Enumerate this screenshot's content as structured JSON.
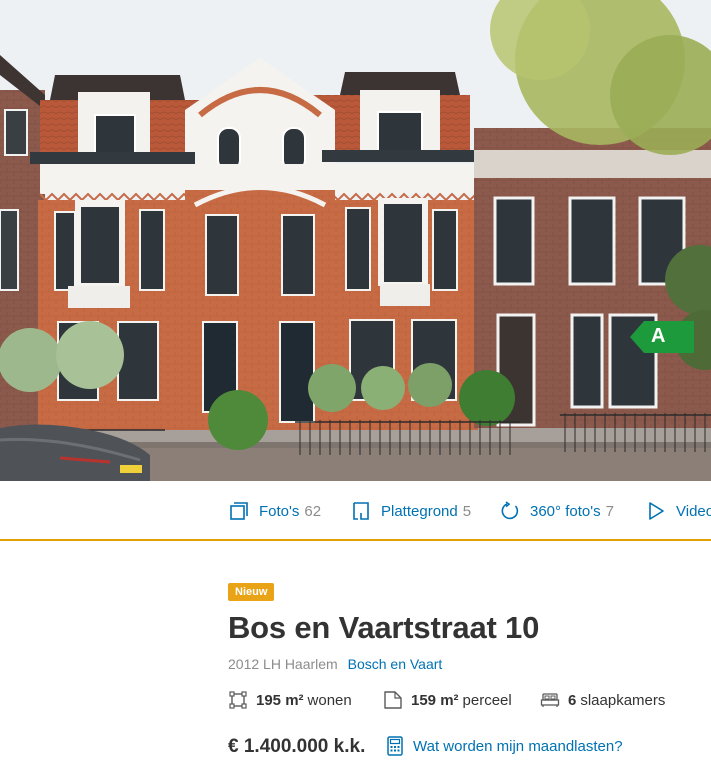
{
  "listing": {
    "badge": "Nieuw",
    "title": "Bos en Vaartstraat 10",
    "postal_city": "2012 LH Haarlem",
    "neighbourhood": "Bosch en Vaart",
    "energy_label": "A",
    "price": "€ 1.400.000 k.k.",
    "monthly_costs_link": "Wat worden mijn maandlasten?"
  },
  "media": [
    {
      "label": "Foto's",
      "count": "62",
      "icon": "photos-icon"
    },
    {
      "label": "Plattegrond",
      "count": "5",
      "icon": "floorplan-icon"
    },
    {
      "label": "360° foto's",
      "count": "7",
      "icon": "rotate-360-icon"
    },
    {
      "label": "Video",
      "count": "",
      "icon": "play-icon"
    }
  ],
  "features": [
    {
      "value": "195 m²",
      "label": "wonen",
      "icon": "living-area-icon"
    },
    {
      "value": "159 m²",
      "label": "perceel",
      "icon": "plot-area-icon"
    },
    {
      "value": "6",
      "label": "slaapkamers",
      "icon": "bed-icon"
    }
  ],
  "colors": {
    "accent_blue": "#0071b3",
    "badge_orange": "#e8a317",
    "divider_gold": "#e2a100",
    "energy_green": "#1d9a3c"
  }
}
